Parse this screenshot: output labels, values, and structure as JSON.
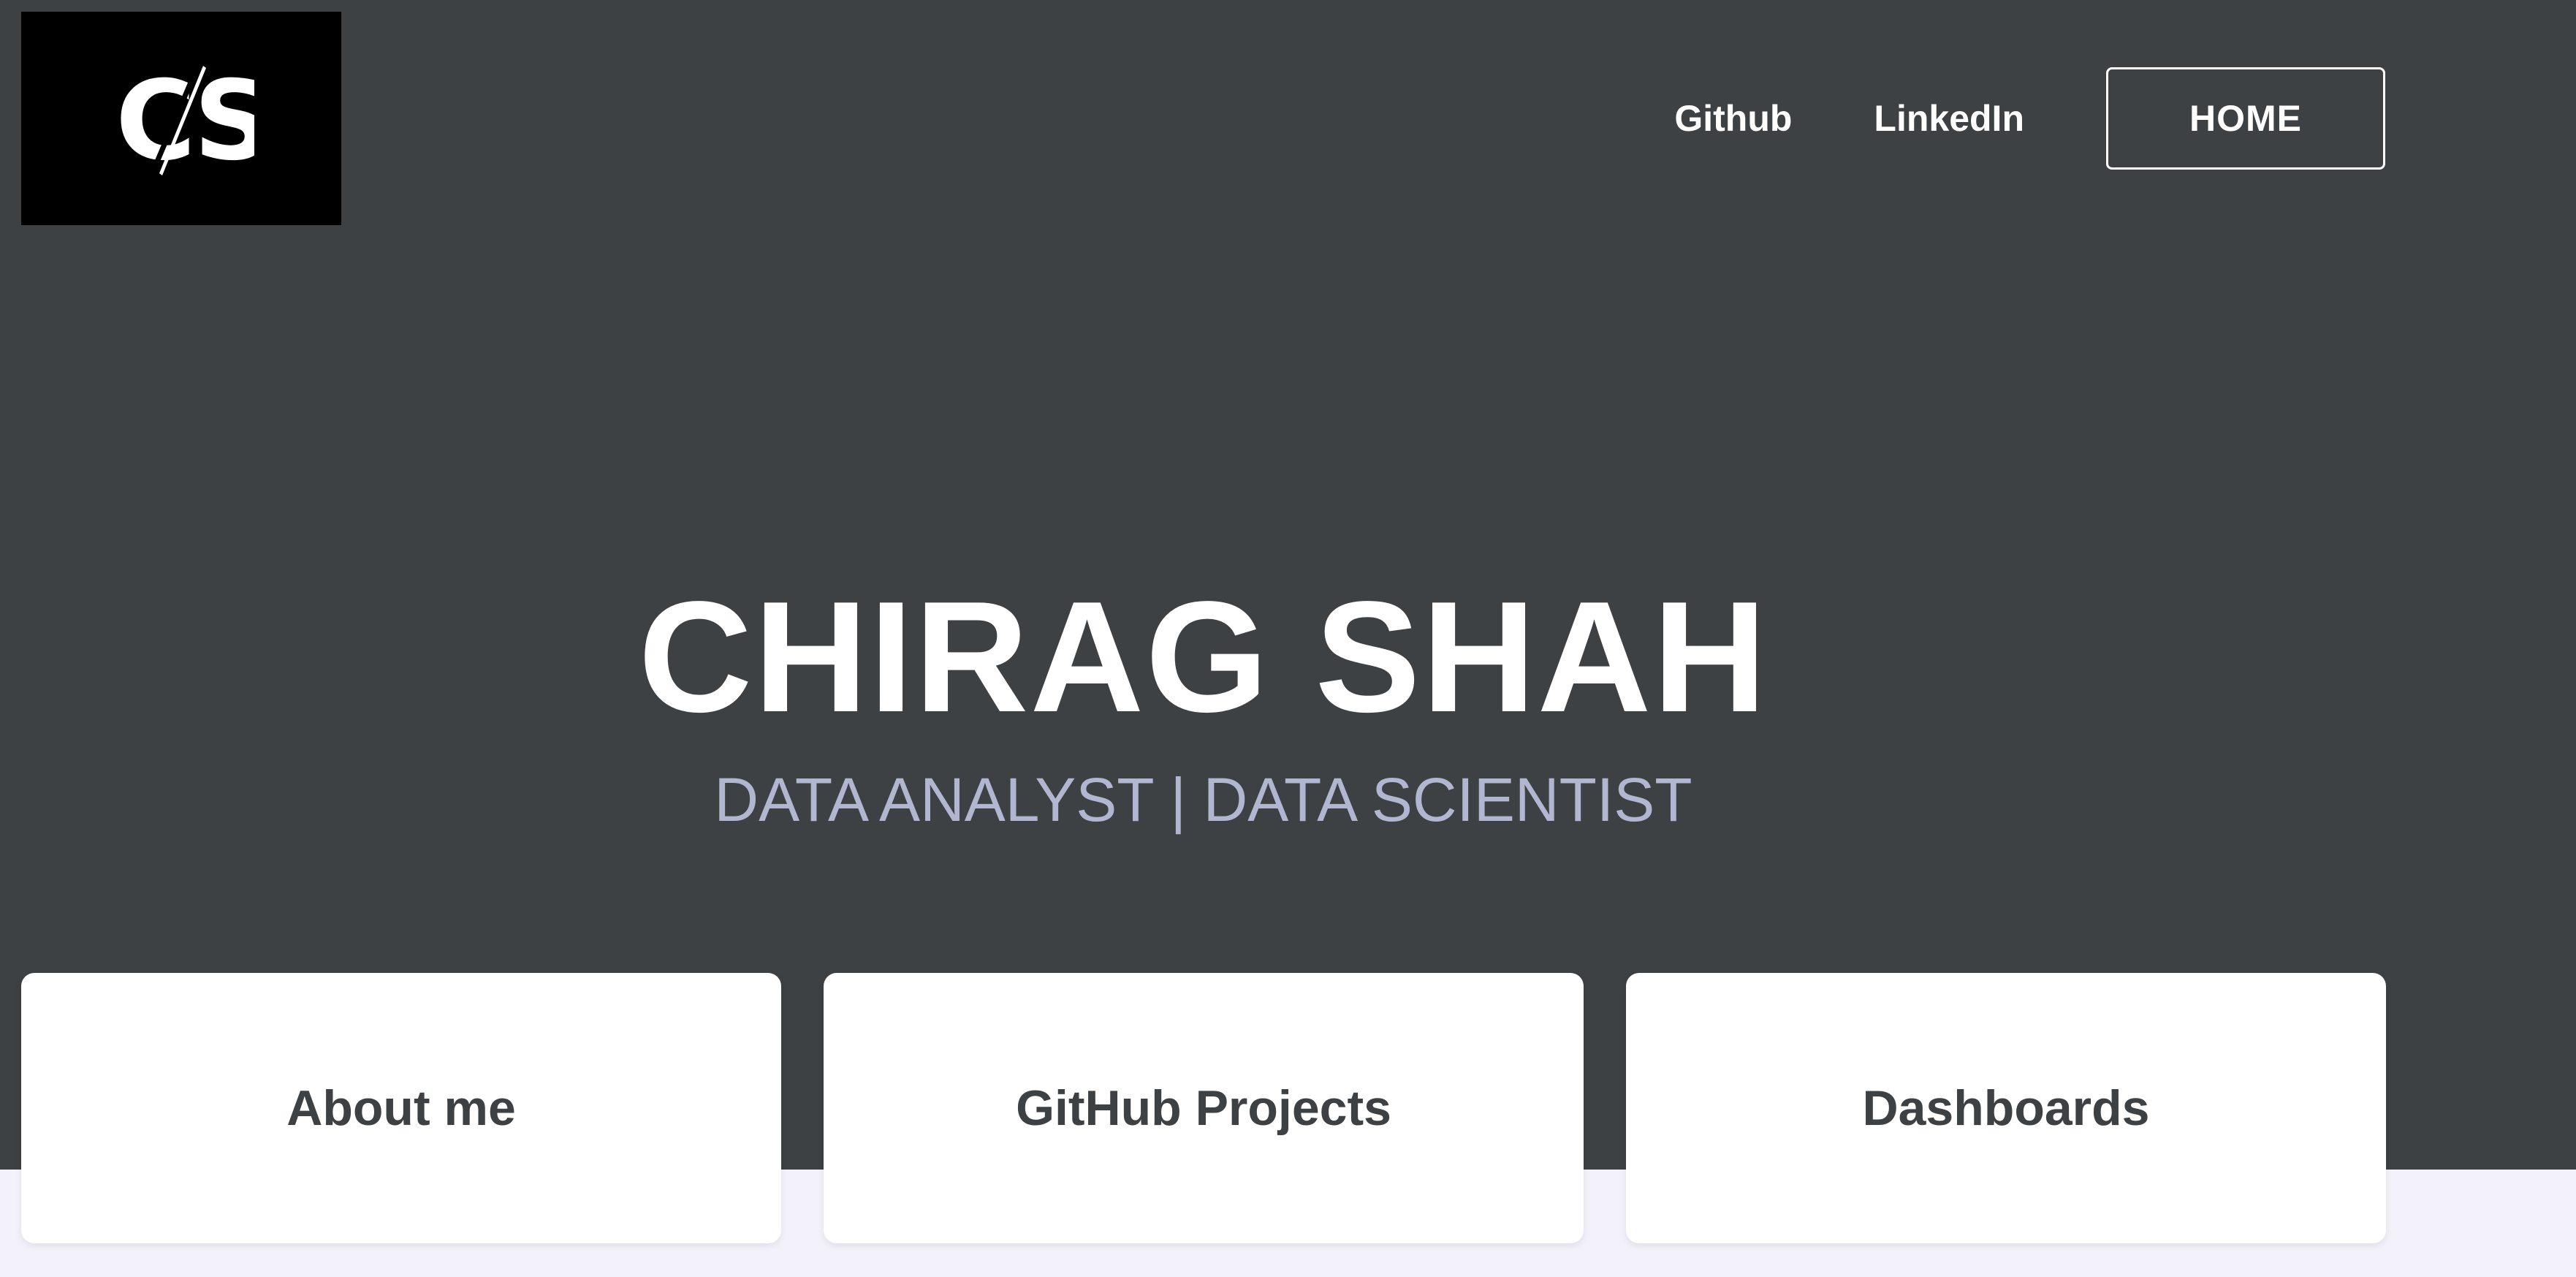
{
  "logo": {
    "text": "CS"
  },
  "nav": {
    "github_label": "Github",
    "linkedin_label": "LinkedIn",
    "home_label": "HOME"
  },
  "hero": {
    "title": "CHIRAG SHAH",
    "subtitle": "DATA ANALYST | DATA SCIENTIST"
  },
  "cards": [
    {
      "label": "About me"
    },
    {
      "label": "GitHub Projects"
    },
    {
      "label": "Dashboards"
    }
  ],
  "colors": {
    "hero_background": "#3d4143",
    "page_background": "#f3f2fb",
    "subtitle": "#b3b6d1",
    "card_background": "#ffffff",
    "card_text": "#3d4143",
    "logo_background": "#000000"
  }
}
